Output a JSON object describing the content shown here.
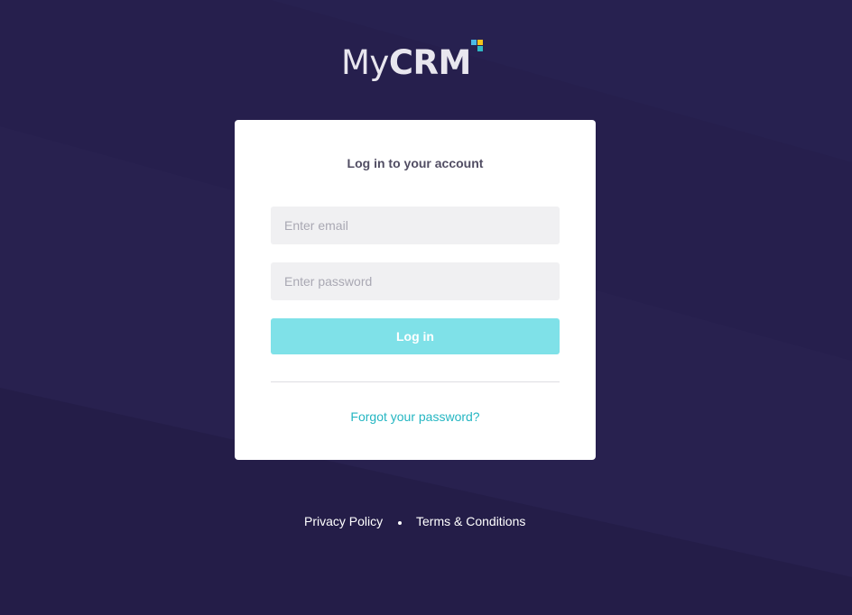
{
  "brand": {
    "logo_my": "My",
    "logo_crm": "CRM",
    "square_colors": [
      "#4bb8e6",
      "#f2c21a",
      "#2fb8c4"
    ]
  },
  "login_card": {
    "title": "Log in to your account",
    "email": {
      "value": "",
      "placeholder": "Enter email"
    },
    "password": {
      "value": "",
      "placeholder": "Enter password"
    },
    "login_label": "Log in",
    "forgot_label": "Forgot your password?"
  },
  "footer": {
    "privacy_label": "Privacy Policy",
    "terms_label": "Terms & Conditions"
  },
  "colors": {
    "background": "#261f4d",
    "accent": "#7fe1e8",
    "link": "#24b6c2"
  }
}
